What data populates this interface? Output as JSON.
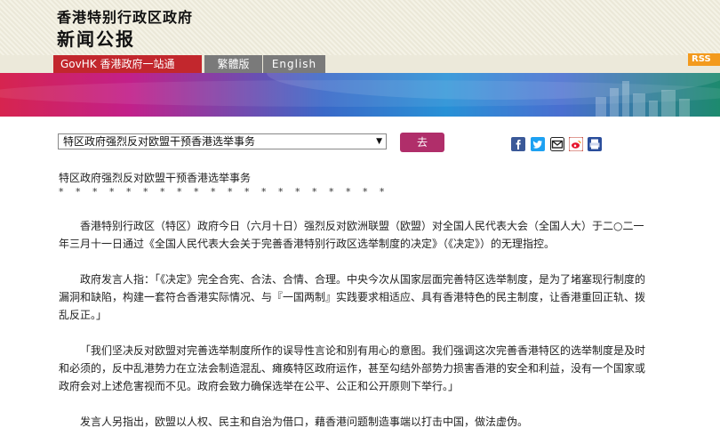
{
  "header": {
    "gov_name": "香港特别行政区政府",
    "press_title": "新闻公报"
  },
  "nav": {
    "govhk": "GovHK 香港政府一站通",
    "traditional": "繁體版",
    "english": "English",
    "rss": "RSS"
  },
  "toolbar": {
    "select_value": "特区政府强烈反对欧盟干预香港选举事务",
    "go_label": "去"
  },
  "share_icons": [
    "facebook-icon",
    "twitter-icon",
    "email-icon",
    "weibo-icon",
    "print-icon"
  ],
  "colors": {
    "govhk_red": "#c2272d",
    "go_button": "#b02e6a",
    "rss_orange": "#f39a1d",
    "facebook": "#3b5998",
    "twitter": "#1da1f2"
  },
  "article": {
    "title": "特区政府强烈反对欧盟干预香港选举事务",
    "stars": "* * * * * * * * * * * * * * * * * * * *",
    "paragraphs": [
      "香港特别行政区（特区）政府今日（六月十日）强烈反对欧洲联盟（欧盟）对全国人民代表大会（全国人大）于二○二一年三月十一日通过《全国人民代表大会关于完善香港特别行政区选举制度的决定》（《决定》）的无理指控。",
      "政府发言人指：「《决定》完全合宪、合法、合情、合理。中央今次从国家层面完善特区选举制度，是为了堵塞现行制度的漏洞和缺陷，构建一套符合香港实际情况、与『一国两制』实践要求相适应、具有香港特色的民主制度，让香港重回正轨、拨乱反正。」",
      "「我们坚决反对欧盟对完善选举制度所作的误导性言论和别有用心的意图。我们强调这次完善香港特区的选举制度是及时和必须的，反中乱港势力在立法会制造混乱、瘫痪特区政府运作，甚至勾结外部势力损害香港的安全和利益，没有一个国家或政府会对上述危害视而不见。政府会致力确保选举在公平、公正和公开原则下举行。」",
      "发言人另指出，欧盟以人权、民主和自治为借口，藉香港问题制造事端以打击中国，做法虚伪。"
    ]
  }
}
